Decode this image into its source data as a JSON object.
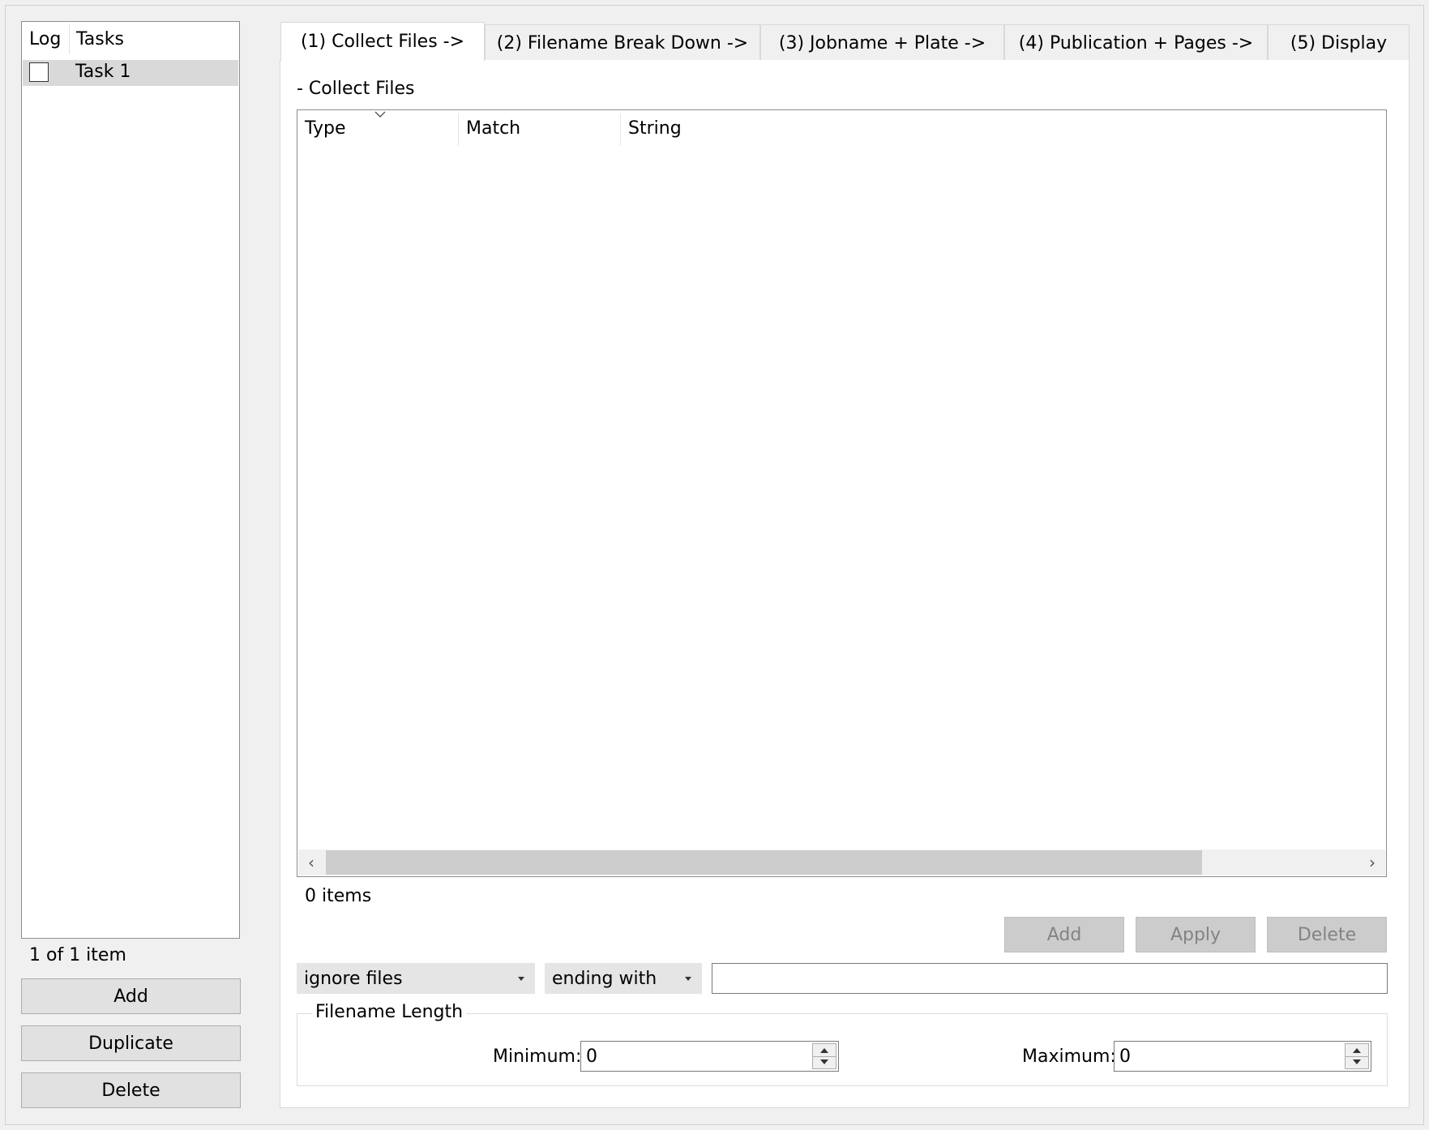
{
  "task_list": {
    "header_log": "Log",
    "header_tasks": "Tasks",
    "rows": [
      {
        "label": "Task 1",
        "checked": false
      }
    ],
    "count": "1 of 1 item",
    "buttons": {
      "add": "Add",
      "duplicate": "Duplicate",
      "delete": "Delete"
    }
  },
  "tabs": [
    {
      "label": "(1) Collect Files ->",
      "active": true
    },
    {
      "label": "(2) Filename Break Down ->",
      "active": false
    },
    {
      "label": "(3) Jobname + Plate ->",
      "active": false
    },
    {
      "label": "(4) Publication + Pages ->",
      "active": false
    },
    {
      "label": "(5) Display",
      "active": false
    }
  ],
  "collect": {
    "section_title": "- Collect Files",
    "columns": [
      "Type",
      "Match",
      "String"
    ],
    "rows": [],
    "items_count": "0 items",
    "buttons": {
      "add": "Add",
      "apply": "Apply",
      "delete": "Delete"
    },
    "type_combo": "ignore files",
    "match_combo": "ending with",
    "string_value": "",
    "filename_length": {
      "title": "Filename Length",
      "min_label": "Minimum:",
      "min_value": "0",
      "max_label": "Maximum:",
      "max_value": "0"
    }
  },
  "icons": {
    "checkbox": "checkbox-icon",
    "sort": "chevron-down-icon",
    "scroll_left": "chevron-left-icon",
    "scroll_right": "chevron-right-icon",
    "dropdown": "caret-down-icon",
    "spin": "spin-arrows-icon"
  },
  "colors": {
    "selection": "#d9d9d9",
    "disabled_button": "#cccccc",
    "window_bg": "#f0f0f0"
  }
}
